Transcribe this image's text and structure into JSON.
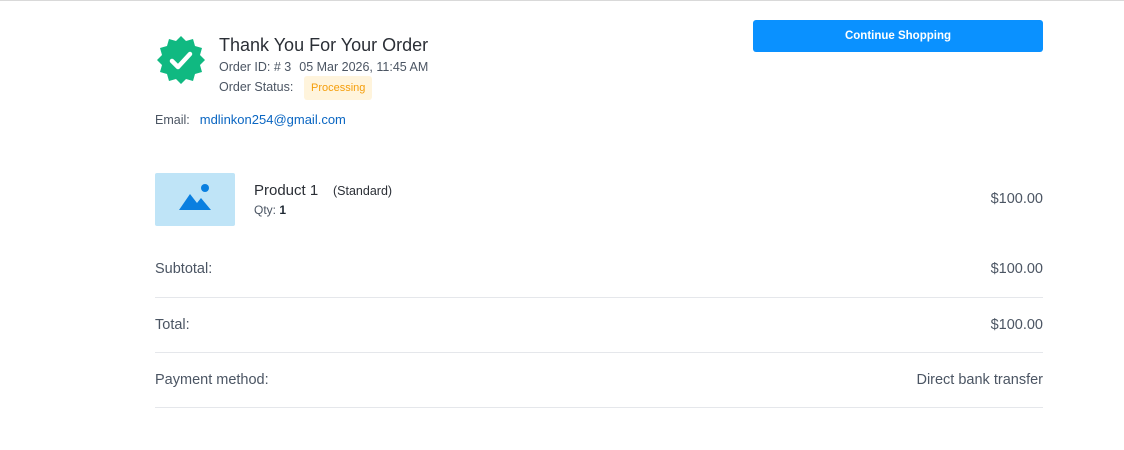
{
  "header": {
    "title": "Thank You For Your Order",
    "order_id_label": "Order ID: # 3",
    "order_date": "05 Mar 2026, 11:45 AM",
    "order_status_label": "Order Status:",
    "order_status_value": "Processing",
    "email_label": "Email:",
    "email_value": "mdlinkon254@gmail.com",
    "continue_button": "Continue Shopping"
  },
  "order_items": [
    {
      "name": "Product 1",
      "variant": "(Standard)",
      "qty_label": "Qty:",
      "qty_value": "1",
      "price": "$100.00"
    }
  ],
  "summary": {
    "subtotal_label": "Subtotal:",
    "subtotal_value": "$100.00",
    "total_label": "Total:",
    "total_value": "$100.00",
    "payment_label": "Payment method:",
    "payment_value": "Direct bank transfer"
  },
  "colors": {
    "accent": "#0a91ff",
    "success": "#10b981",
    "status_bg": "#fff4dc",
    "status_text": "#f59e0b",
    "link": "#0a66c2"
  },
  "icons": {
    "badge": "verified-check-icon",
    "thumbnail": "image-placeholder-icon"
  }
}
